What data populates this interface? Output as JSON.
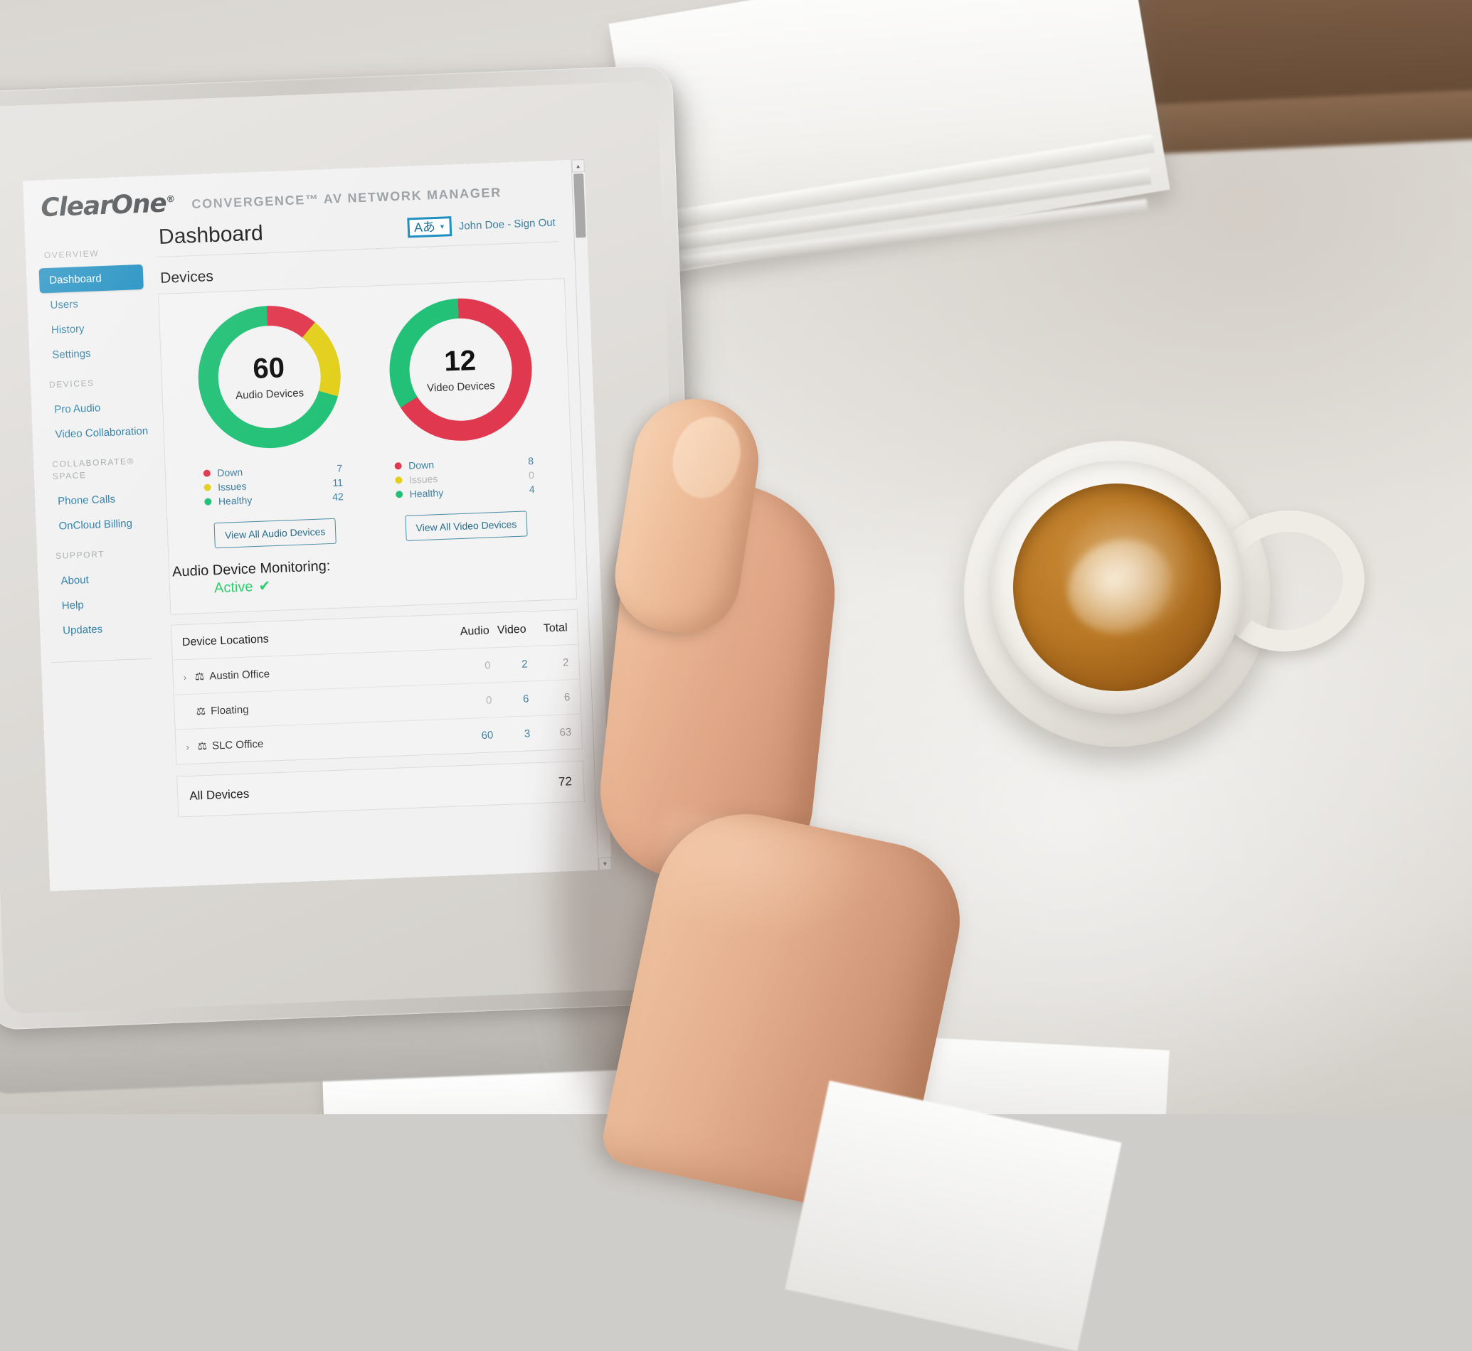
{
  "brand": {
    "logo_text": "ClearOne",
    "logo_registered": "®",
    "product_name": "CONVERGENCE™ AV NETWORK MANAGER"
  },
  "header": {
    "page_title": "Dashboard",
    "language_label": "Aあ",
    "language_caret": "▼",
    "user_text": "John Doe - Sign Out"
  },
  "sidebar": {
    "groups": [
      {
        "label": "OVERVIEW",
        "items": [
          {
            "label": "Dashboard",
            "active": true
          },
          {
            "label": "Users",
            "active": false
          },
          {
            "label": "History",
            "active": false
          },
          {
            "label": "Settings",
            "active": false
          }
        ]
      },
      {
        "label": "DEVICES",
        "items": [
          {
            "label": "Pro Audio",
            "active": false
          },
          {
            "label": "Video Collaboration",
            "active": false
          }
        ]
      },
      {
        "label": "COLLABORATE® SPACE",
        "items": [
          {
            "label": "Phone Calls",
            "active": false
          },
          {
            "label": "OnCloud Billing",
            "active": false
          }
        ]
      },
      {
        "label": "SUPPORT",
        "items": [
          {
            "label": "About",
            "active": false
          },
          {
            "label": "Help",
            "active": false
          },
          {
            "label": "Updates",
            "active": false
          }
        ]
      }
    ]
  },
  "main": {
    "devices_section_title": "Devices",
    "audio": {
      "count": "60",
      "caption": "Audio Devices",
      "legend": [
        {
          "label": "Down",
          "value": "7",
          "color": "#e0394f"
        },
        {
          "label": "Issues",
          "value": "11",
          "color": "#e3cf1c"
        },
        {
          "label": "Healthy",
          "value": "42",
          "color": "#23c177"
        }
      ],
      "button_label": "View All Audio Devices"
    },
    "video": {
      "count": "12",
      "caption": "Video Devices",
      "legend": [
        {
          "label": "Down",
          "value": "8",
          "color": "#e0394f"
        },
        {
          "label": "Issues",
          "value": "0",
          "color": "#e3cf1c"
        },
        {
          "label": "Healthy",
          "value": "4",
          "color": "#23c177"
        }
      ],
      "button_label": "View All Video Devices"
    },
    "monitoring": {
      "label": "Audio Device Monitoring:",
      "status": "Active",
      "check": "✔"
    },
    "locations_table": {
      "columns": [
        "Device Locations",
        "Audio",
        "Video",
        "Total"
      ],
      "rows": [
        {
          "name": "Austin Office",
          "expandable": true,
          "audio": "0",
          "video": "2",
          "total": "2"
        },
        {
          "name": "Floating",
          "expandable": false,
          "audio": "0",
          "video": "6",
          "total": "6"
        },
        {
          "name": "SLC Office",
          "expandable": true,
          "audio": "60",
          "video": "3",
          "total": "63"
        }
      ]
    },
    "all_devices": {
      "label": "All Devices",
      "value": "72"
    }
  },
  "icons": {
    "chevron_right": "›",
    "location_pin": "⚐",
    "scroll_up": "▲",
    "scroll_down": "▼"
  },
  "chart_data": [
    {
      "type": "pie",
      "title": "Audio Devices",
      "center_value": 60,
      "categories": [
        "Healthy",
        "Down",
        "Issues"
      ],
      "values": [
        42,
        7,
        11
      ],
      "colors": [
        "#23c177",
        "#e0394f",
        "#e3cf1c"
      ],
      "legend_position": "below"
    },
    {
      "type": "pie",
      "title": "Video Devices",
      "center_value": 12,
      "categories": [
        "Healthy",
        "Down",
        "Issues"
      ],
      "values": [
        4,
        8,
        0
      ],
      "colors": [
        "#23c177",
        "#e0394f",
        "#e3cf1c"
      ],
      "legend_position": "below"
    }
  ]
}
